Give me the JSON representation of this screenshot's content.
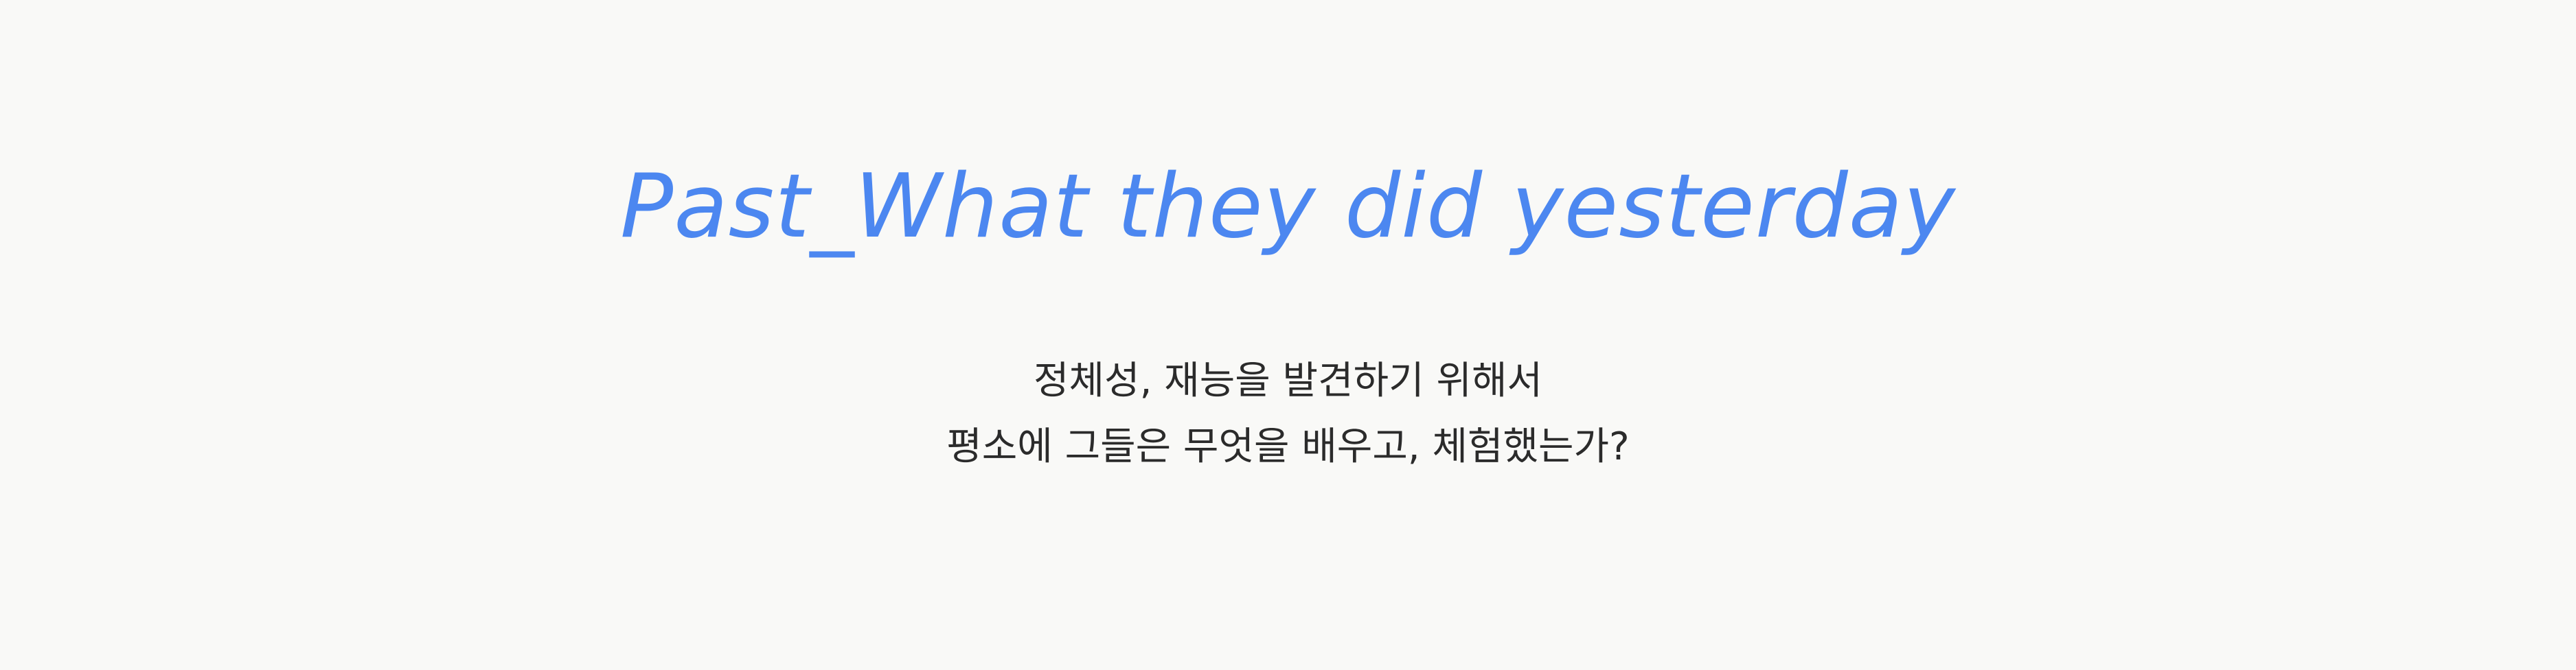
{
  "section": {
    "title": "Past_What they did yesterday",
    "subtitle_lines": [
      "정체성, 재능을 발견하기 위해서",
      "평소에 그들은 무엇을 배우고, 체험했는가?"
    ]
  },
  "colors": {
    "background": "#f9f9f7",
    "title": "#4c87f0",
    "body_text": "#2b2b2b"
  }
}
